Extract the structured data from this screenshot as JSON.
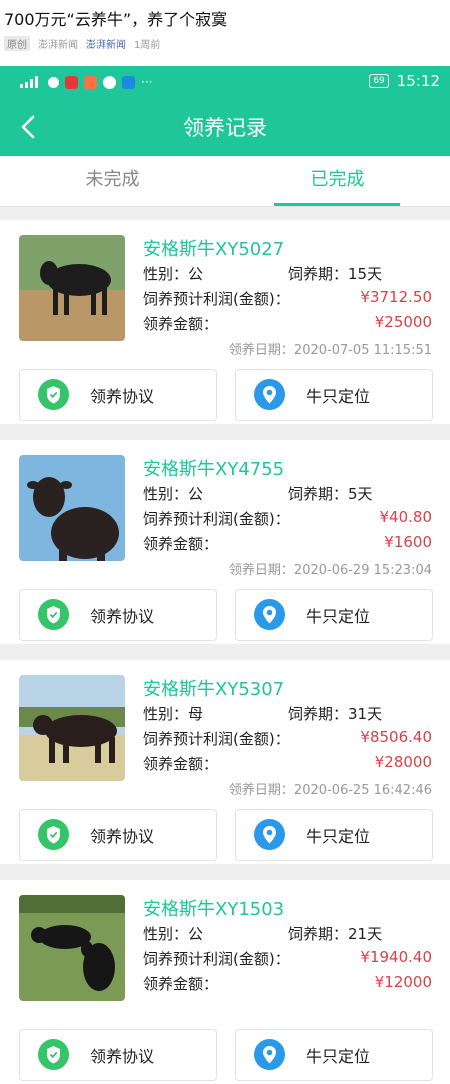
{
  "article": {
    "title": "700万元“云养牛”，养了个寂寞",
    "tag": "原创",
    "source": "澎湃新闻",
    "source_link": "澎湃新闻",
    "time": "1周前"
  },
  "status_bar": {
    "battery": "69",
    "time": "15:12"
  },
  "nav": {
    "title": "领养记录"
  },
  "tabs": [
    {
      "label": "未完成",
      "active": false
    },
    {
      "label": "已完成",
      "active": true
    }
  ],
  "labels": {
    "gender": "性别：",
    "period": "饲养期：",
    "profit": "饲养预计利润(金额)：",
    "amount": "领养金额：",
    "date": "领养日期：",
    "agreement_btn": "领养协议",
    "locate_btn": "牛只定位"
  },
  "records": [
    {
      "name": "安格斯牛XY5027",
      "gender": "公",
      "period": "15天",
      "profit": "¥3712.50",
      "amount": "¥25000",
      "date": "2020-07-05 11:15:51"
    },
    {
      "name": "安格斯牛XY4755",
      "gender": "公",
      "period": "5天",
      "profit": "¥40.80",
      "amount": "¥1600",
      "date": "2020-06-29 15:23:04"
    },
    {
      "name": "安格斯牛XY5307",
      "gender": "母",
      "period": "31天",
      "profit": "¥8506.40",
      "amount": "¥28000",
      "date": "2020-06-25 16:42:46"
    },
    {
      "name": "安格斯牛XY1503",
      "gender": "公",
      "period": "21天",
      "profit": "¥1940.40",
      "amount": "¥12000",
      "date": ""
    }
  ],
  "colors": {
    "accent": "#1fc69a",
    "money": "#d8424a"
  }
}
